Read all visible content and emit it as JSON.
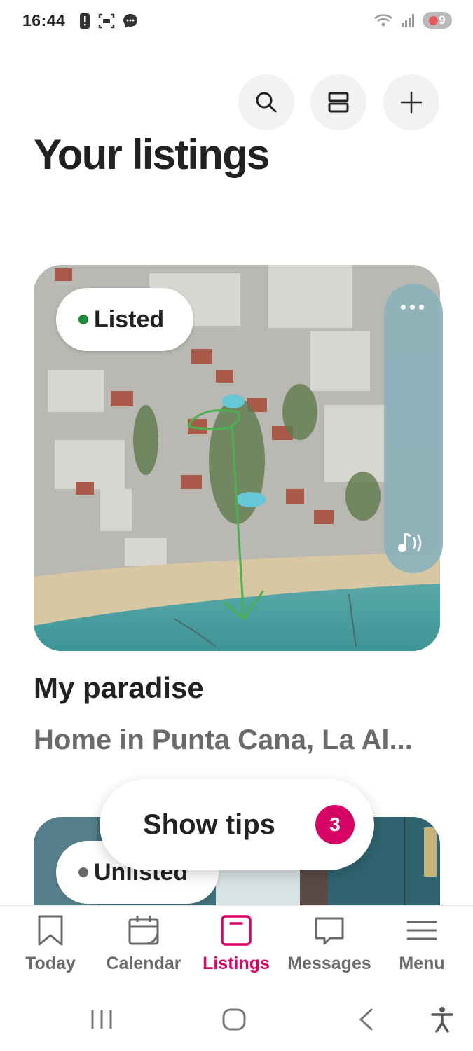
{
  "status_bar": {
    "time": "16:44",
    "battery": "9",
    "icons_left": [
      "alert-icon",
      "screenshot-icon",
      "chat-bubble-icon"
    ],
    "icons_right": [
      "wifi-icon",
      "signal-icon",
      "battery-icon"
    ]
  },
  "header": {
    "title": "Your listings",
    "actions": [
      "search-icon",
      "layout-toggle-icon",
      "add-icon"
    ]
  },
  "listings": [
    {
      "status": "Listed",
      "status_color": "#1a8a3a",
      "name": "My paradise",
      "subtitle": "Home in Punta Cana, La Al..."
    },
    {
      "status": "Unlisted",
      "status_color": "#6a6a6a"
    }
  ],
  "tips": {
    "label": "Show tips",
    "count": "3"
  },
  "bottom_nav": {
    "items": [
      {
        "label": "Today",
        "icon": "bookmark-icon",
        "active": false
      },
      {
        "label": "Calendar",
        "icon": "calendar-icon",
        "active": false
      },
      {
        "label": "Listings",
        "icon": "listings-icon",
        "active": true
      },
      {
        "label": "Messages",
        "icon": "message-icon",
        "active": false
      },
      {
        "label": "Menu",
        "icon": "menu-icon",
        "active": false
      }
    ]
  },
  "colors": {
    "accent": "#d70466",
    "text": "#222222",
    "muted": "#6a6a6a",
    "panel": "#8fb3bb"
  }
}
